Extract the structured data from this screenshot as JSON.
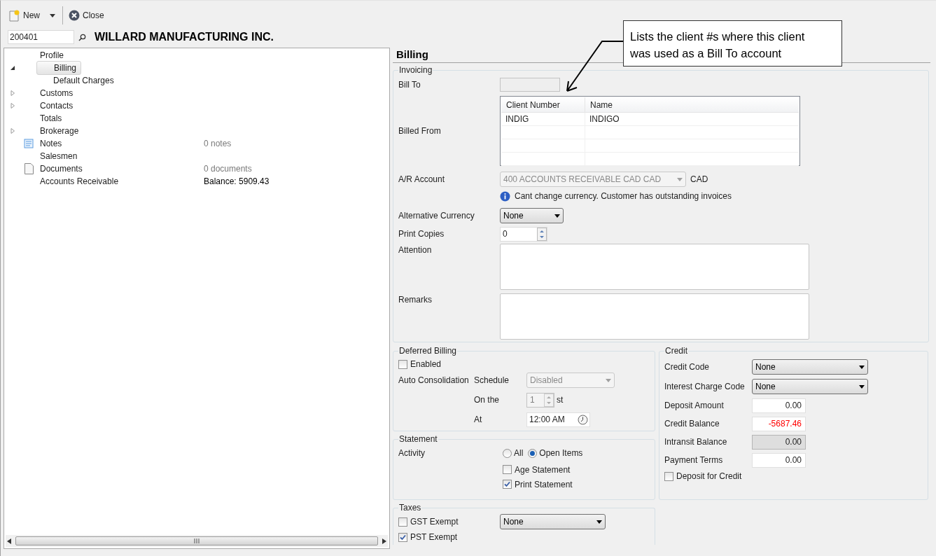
{
  "toolbar": {
    "buttons": [
      {
        "label": "New",
        "kind": "new"
      },
      {
        "label": "Close",
        "kind": "close"
      }
    ]
  },
  "client": {
    "number": "200401",
    "name": "WILLARD MANUFACTURING INC."
  },
  "tree": [
    {
      "label": "Profile",
      "selected": false
    },
    {
      "label": "Billing",
      "selected": true,
      "expanded": true,
      "children": [
        {
          "label": "Default Charges",
          "selected": false
        }
      ]
    },
    {
      "label": "Customs",
      "selected": false,
      "expanded": false
    },
    {
      "label": "Contacts",
      "selected": false,
      "expanded": false
    },
    {
      "label": "Totals",
      "selected": false
    },
    {
      "label": "Brokerage",
      "selected": false,
      "expanded": false
    },
    {
      "label": "Notes",
      "selected": false,
      "kind": "notes",
      "info": "0 notes",
      "muted": true
    },
    {
      "label": "Salesmen",
      "selected": false
    },
    {
      "label": "Documents",
      "selected": false,
      "kind": "document",
      "info": "0 documents",
      "muted": true
    },
    {
      "label": "Accounts Receivable",
      "selected": false,
      "info": "Balance: 5909.43",
      "muted": false
    }
  ],
  "callout": {
    "text": "Lists the client #s where this client was used as a Bill To account"
  },
  "billing": {
    "title": "Billing",
    "invoicing": {
      "legend": "Invoicing",
      "bill_to": {
        "label": "Bill To",
        "disabled": true
      },
      "billed_from": {
        "label": "Billed From",
        "columns": [
          "Client Number",
          "Name"
        ],
        "rows": [
          [
            "INDIG",
            "INDIGO"
          ]
        ]
      },
      "ar_account": {
        "label": "A/R Account",
        "value": "400 ACCOUNTS RECEIVABLE CAD CAD",
        "disabled": true,
        "currency": "CAD",
        "note": "Cant change currency. Customer has outstanding invoices"
      },
      "alt_currency": {
        "label": "Alternative Currency",
        "value": "None"
      },
      "print_copies": {
        "label": "Print Copies",
        "value": "0"
      },
      "attention": {
        "label": "Attention"
      },
      "remarks": {
        "label": "Remarks"
      }
    },
    "deferred": {
      "legend": "Deferred Billing",
      "enabled": {
        "label": "Enabled",
        "checked": false
      },
      "auto_label": "Auto Consolidation",
      "schedule": {
        "label": "Schedule",
        "value": "Disabled",
        "disabled": true
      },
      "on_the": {
        "label": "On the",
        "value": "1",
        "suffix": "st",
        "disabled": true
      },
      "at": {
        "label": "At",
        "value": "12:00 AM"
      }
    },
    "statement": {
      "legend": "Statement",
      "activity_label": "Activity",
      "radios": [
        {
          "label": "All",
          "selected": false
        },
        {
          "label": "Open Items",
          "selected": true
        }
      ],
      "checks": [
        {
          "label": "Age Statement",
          "checked": false
        },
        {
          "label": "Print Statement",
          "checked": true
        }
      ]
    },
    "taxes": {
      "legend": "Taxes",
      "rows": [
        {
          "label": "GST Exempt",
          "checked": false,
          "select": "None"
        },
        {
          "label": "PST Exempt",
          "checked": true
        }
      ]
    },
    "credit": {
      "legend": "Credit",
      "selects": [
        {
          "label": "Credit Code",
          "value": "None"
        },
        {
          "label": "Interest Charge Code",
          "value": "None"
        }
      ],
      "amounts": [
        {
          "label": "Deposit Amount",
          "value": "0.00",
          "disabled": false,
          "negative": false
        },
        {
          "label": "Credit Balance",
          "value": "-5687.46",
          "disabled": false,
          "negative": true
        },
        {
          "label": "Intransit Balance",
          "value": "0.00",
          "disabled": true,
          "negative": false
        },
        {
          "label": "Payment Terms",
          "value": "0.00",
          "disabled": false,
          "negative": false
        }
      ],
      "deposit_for_credit": {
        "label": "Deposit for Credit",
        "checked": false
      }
    }
  }
}
